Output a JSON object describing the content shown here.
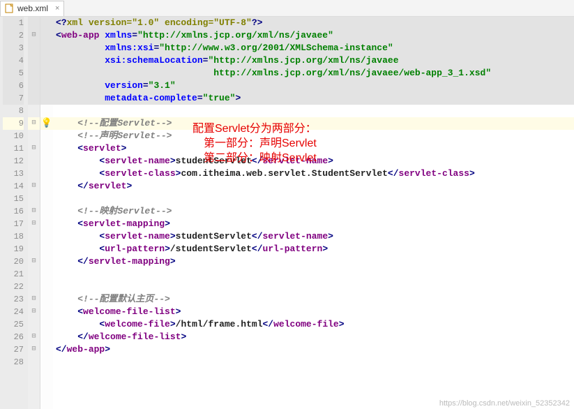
{
  "tab": {
    "filename": "web.xml",
    "close": "×"
  },
  "gutter_lines": 28,
  "fold_marks": {
    "2": "⊟",
    "9": "⊟",
    "11": "⊟",
    "14": "⊟",
    "16": "⊟",
    "17": "⊟",
    "20": "⊟",
    "23": "⊟",
    "24": "⊟",
    "26": "⊟",
    "27": "⊟"
  },
  "icon_marks": {
    "9": "bulb"
  },
  "highlight_rows": {
    "decl": [
      1,
      2,
      3,
      4,
      5,
      6,
      7
    ],
    "warn": [
      9
    ]
  },
  "code": {
    "l1_open": "<?",
    "l1_pi": "xml version=\"1.0\" encoding=\"UTF-8\"",
    "l1_close": "?>",
    "tag_webapp": "web-app",
    "a_xmlns": "xmlns",
    "v_xmlns": "\"http://xmlns.jcp.org/xml/ns/javaee\"",
    "a_xsi": "xmlns:xsi",
    "v_xsi": "\"http://www.w3.org/2001/XMLSchema-instance\"",
    "a_loc": "xsi:schemaLocation",
    "v_loc": "\"http://xmlns.jcp.org/xml/ns/javaee",
    "v_loc2": "http://xmlns.jcp.org/xml/ns/javaee/web-app_3_1.xsd\"",
    "a_ver": "version",
    "v_ver": "\"3.1\"",
    "a_meta": "metadata-complete",
    "v_meta": "\"true\"",
    "cmt_cfg": "<!--配置Servlet-->",
    "cmt_decl": "<!--声明Servlet-->",
    "tag_servlet": "servlet",
    "tag_servlet_name": "servlet-name",
    "tag_servlet_class": "servlet-class",
    "txt_studentServlet": "studentServlet",
    "txt_class": "com.itheima.web.servlet.StudentServlet",
    "cmt_map": "<!--映射Servlet-->",
    "tag_servlet_mapping": "servlet-mapping",
    "tag_url_pattern": "url-pattern",
    "txt_urlp": "/studentServlet",
    "cmt_welcome": "<!--配置默认主页-->",
    "tag_wfl": "welcome-file-list",
    "tag_wf": "welcome-file",
    "txt_wf": "/html/frame.html"
  },
  "annotation": {
    "line1": "配置Servlet分为两部分：",
    "line2": "第一部分：声明Servlet",
    "line3": "第二部分：映射Servlet"
  },
  "watermark": "https://blog.csdn.net/weixin_52352342"
}
